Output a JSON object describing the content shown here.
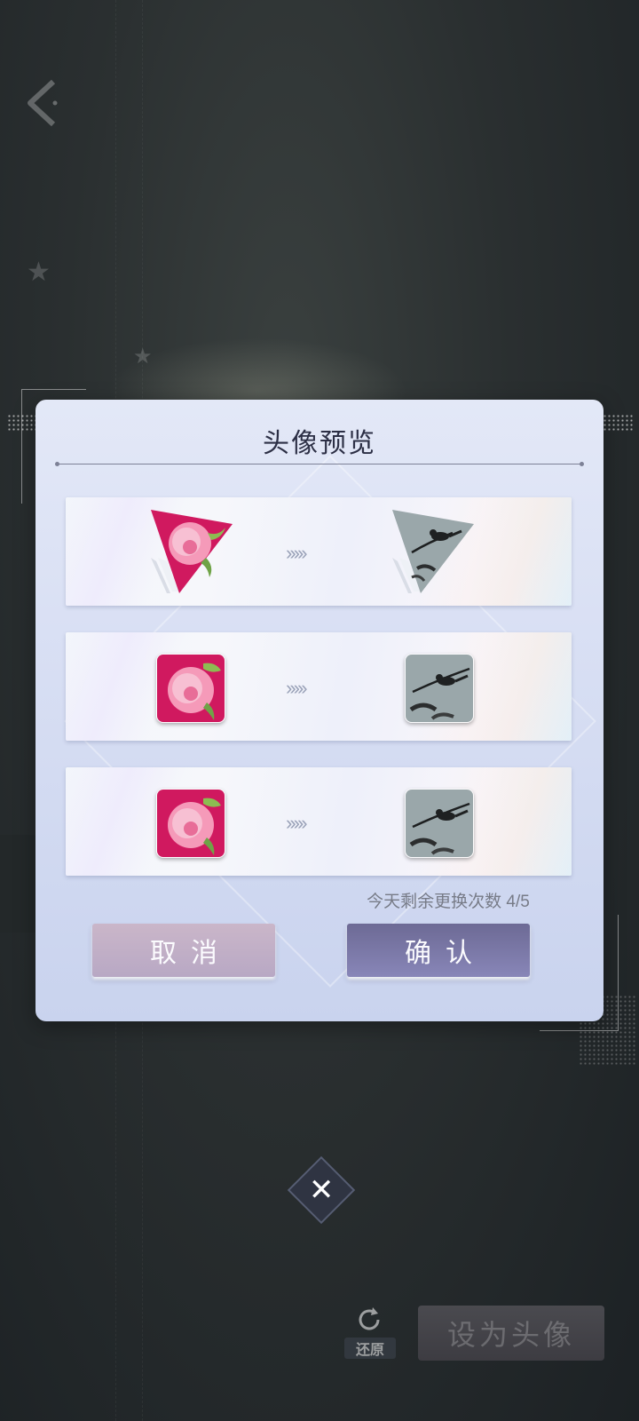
{
  "dialog": {
    "title": "头像预览",
    "rows": [
      {
        "shape": "triangle",
        "from": "peony-avatar",
        "to": "bird-ink-avatar"
      },
      {
        "shape": "square-large",
        "from": "peony-avatar",
        "to": "bird-ink-avatar"
      },
      {
        "shape": "square-small",
        "from": "peony-avatar",
        "to": "bird-ink-avatar"
      }
    ],
    "arrows": "›››››",
    "remaining_text": "今天剩余更换次数 4/5",
    "cancel_label": "取消",
    "confirm_label": "确认"
  },
  "footer": {
    "close_label": "✕",
    "restore_label": "还原",
    "set_avatar_label": "设为头像"
  },
  "colors": {
    "cancel": "#c3b2c7",
    "confirm": "#7a78a8",
    "peony_bg": "#d0195f",
    "ink_bg": "#9aa7aa"
  }
}
